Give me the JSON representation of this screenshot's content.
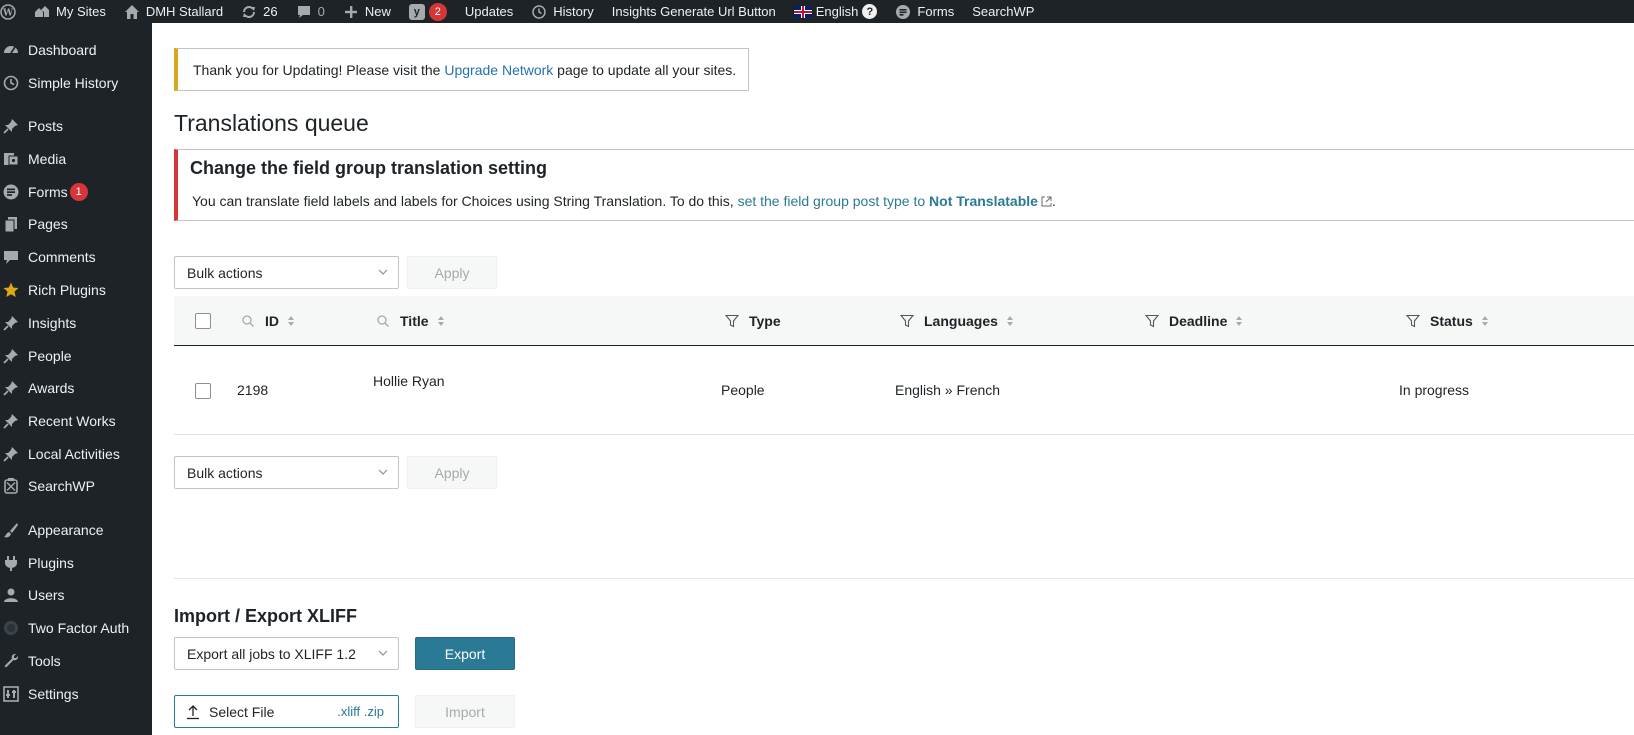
{
  "admin_bar": {
    "my_sites": "My Sites",
    "site_name": "DMH Stallard",
    "updates_count": "26",
    "comments_count": "0",
    "new_label": "New",
    "yoast_badge": "2",
    "updates_label": "Updates",
    "history_label": "History",
    "insights_label": "Insights Generate Url Button",
    "language_label": "English",
    "forms_label": "Forms",
    "searchwp_label": "SearchWP"
  },
  "sidebar": {
    "items": [
      {
        "label": "Dashboard",
        "icon": "dashboard-icon"
      },
      {
        "label": "Simple History",
        "icon": "history-icon"
      },
      {
        "label": "Posts",
        "icon": "pin-icon"
      },
      {
        "label": "Media",
        "icon": "media-icon"
      },
      {
        "label": "Forms",
        "icon": "forms-icon",
        "badge": "1"
      },
      {
        "label": "Pages",
        "icon": "pages-icon"
      },
      {
        "label": "Comments",
        "icon": "comments-icon"
      },
      {
        "label": "Rich Plugins",
        "icon": "star-icon"
      },
      {
        "label": "Insights",
        "icon": "pin-icon"
      },
      {
        "label": "People",
        "icon": "pin-icon"
      },
      {
        "label": "Awards",
        "icon": "pin-icon"
      },
      {
        "label": "Recent Works",
        "icon": "pin-icon"
      },
      {
        "label": "Local Activities",
        "icon": "pin-icon"
      },
      {
        "label": "SearchWP",
        "icon": "searchwp-icon"
      },
      {
        "label": "Appearance",
        "icon": "brush-icon"
      },
      {
        "label": "Plugins",
        "icon": "plugin-icon"
      },
      {
        "label": "Users",
        "icon": "users-icon"
      },
      {
        "label": "Two Factor Auth",
        "icon": "shield-icon"
      },
      {
        "label": "Tools",
        "icon": "wrench-icon"
      },
      {
        "label": "Settings",
        "icon": "settings-icon"
      }
    ]
  },
  "notice": {
    "before": "Thank you for Updating! Please visit the ",
    "link": "Upgrade Network",
    "after": " page to update all your sites."
  },
  "page_title": "Translations queue",
  "error_notice": {
    "title": "Change the field group translation setting",
    "text": "You can translate field labels and labels for Choices using String Translation. To do this, ",
    "link_text": "set the field group post type to ",
    "link_strong": "Not Translatable",
    "after": "."
  },
  "bulk_top": {
    "select": "Bulk actions",
    "apply": "Apply"
  },
  "bulk_bottom": {
    "select": "Bulk actions",
    "apply": "Apply"
  },
  "table": {
    "columns": [
      "ID",
      "Title",
      "Type",
      "Languages",
      "Deadline",
      "Status"
    ],
    "rows": [
      {
        "id": "2198",
        "title": "Hollie Ryan",
        "type": "People",
        "languages": "English » French",
        "deadline": "",
        "status": "In progress"
      }
    ]
  },
  "import_export": {
    "title": "Import / Export XLIFF",
    "export_select": "Export all jobs to XLIFF 1.2",
    "export_button": "Export",
    "select_file": "Select File",
    "file_ext": ".xliff .zip",
    "import_button": "Import"
  },
  "colors": {
    "accent": "#2b7a95",
    "admin_bar": "#1d2327",
    "error": "#d63638",
    "warning": "#dba617"
  }
}
